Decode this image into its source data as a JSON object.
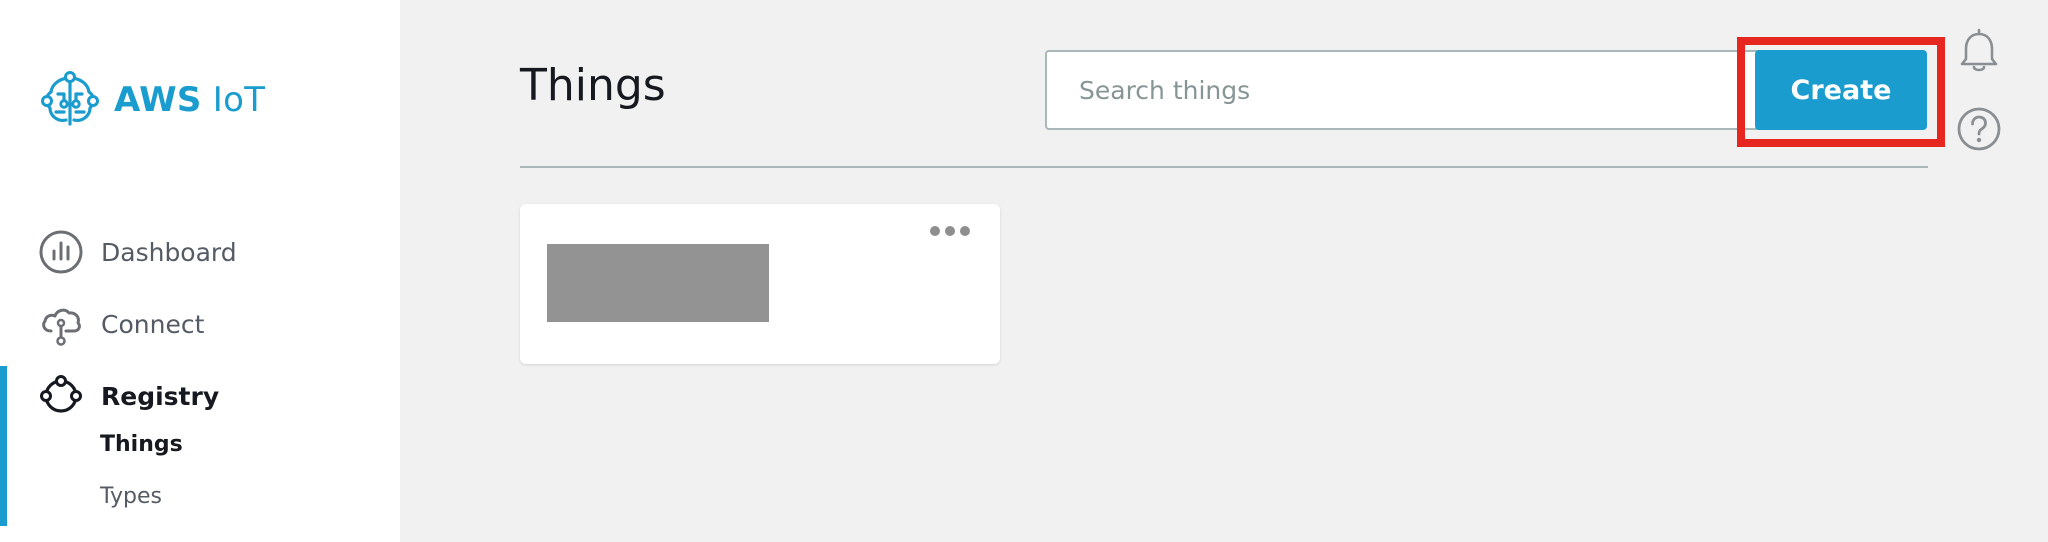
{
  "brand": {
    "name_bold": "AWS",
    "name_light": " IoT",
    "logo_icon": "iot-brain-icon",
    "color": "#1a9ccf"
  },
  "nav": {
    "items": [
      {
        "label": "Dashboard",
        "icon": "chart-circle-icon",
        "active": false
      },
      {
        "label": "Connect",
        "icon": "cloud-connect-icon",
        "active": false
      },
      {
        "label": "Registry",
        "icon": "registry-nodes-icon",
        "active": true
      }
    ],
    "sub_items": [
      {
        "label": "Things",
        "active": true
      },
      {
        "label": "Types",
        "active": false
      }
    ]
  },
  "main": {
    "title": "Things",
    "search": {
      "placeholder": "Search things",
      "value": ""
    },
    "create_label": "Create",
    "header_icons": [
      "bell-icon",
      "help-icon"
    ],
    "card": {
      "menu_icon": "more-dots-icon",
      "name": ""
    }
  },
  "colors": {
    "accent": "#1a9ccf",
    "highlight": "#e7261f",
    "background": "#f1f1f1"
  }
}
